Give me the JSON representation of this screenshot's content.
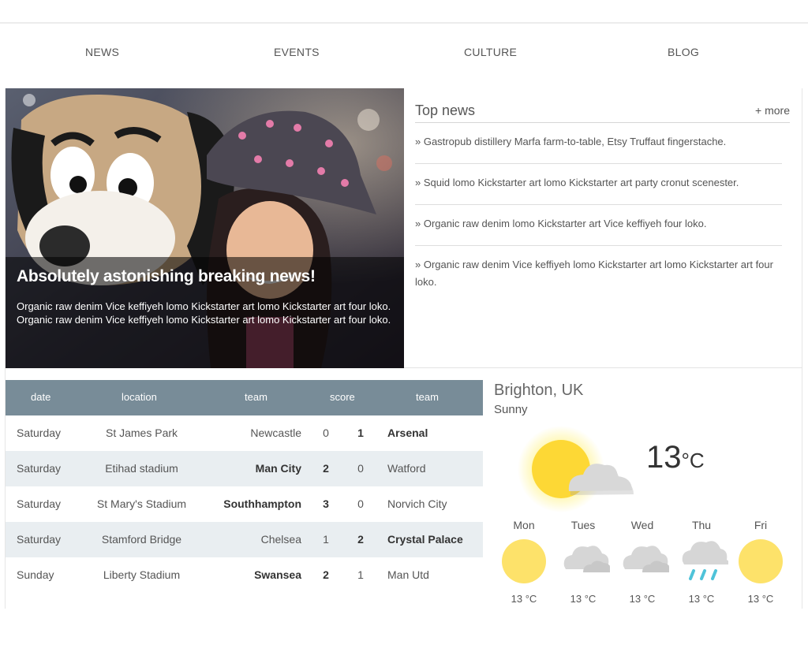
{
  "nav": {
    "items": [
      "NEWS",
      "EVENTS",
      "CULTURE",
      "BLOG"
    ]
  },
  "hero": {
    "title": "Absolutely astonishing breaking news!",
    "text": "Organic raw denim Vice keffiyeh lomo Kickstarter art lomo Kickstarter art four loko. Organic raw denim Vice keffiyeh lomo Kickstarter art lomo Kickstarter art four loko."
  },
  "top_news": {
    "title": "Top news",
    "more": "+ more",
    "items": [
      "» Gastropub distillery Marfa farm-to-table, Etsy Truffaut fingerstache.",
      "» Squid lomo Kickstarter art lomo Kickstarter art party cronut scenester.",
      "» Organic raw denim lomo Kickstarter art Vice keffiyeh four loko.",
      "» Organic raw denim Vice keffiyeh lomo Kickstarter art lomo Kickstarter art four loko."
    ]
  },
  "scores": {
    "headers": [
      "date",
      "location",
      "team",
      "score",
      "team"
    ],
    "rows": [
      {
        "date": "Saturday",
        "location": "St James Park",
        "home": "Newcastle",
        "home_score": "0",
        "away_score": "1",
        "away": "Arsenal",
        "winner": "away"
      },
      {
        "date": "Saturday",
        "location": "Etihad stadium",
        "home": "Man City",
        "home_score": "2",
        "away_score": "0",
        "away": "Watford",
        "winner": "home"
      },
      {
        "date": "Saturday",
        "location": "St Mary's Stadium",
        "home": "Southhampton",
        "home_score": "3",
        "away_score": "0",
        "away": "Norvich City",
        "winner": "home"
      },
      {
        "date": "Saturday",
        "location": "Stamford Bridge",
        "home": "Chelsea",
        "home_score": "1",
        "away_score": "2",
        "away": "Crystal Palace",
        "winner": "away"
      },
      {
        "date": "Sunday",
        "location": "Liberty Stadium",
        "home": "Swansea",
        "home_score": "2",
        "away_score": "1",
        "away": "Man Utd",
        "winner": "home"
      }
    ]
  },
  "weather": {
    "city": "Brighton, UK",
    "condition": "Sunny",
    "temp": "13",
    "unit": "°C",
    "current_icon": "sun-cloud-icon",
    "forecast": [
      {
        "day": "Mon",
        "temp": "13 °C",
        "icon": "sun-icon"
      },
      {
        "day": "Tues",
        "temp": "13 °C",
        "icon": "cloud-icon"
      },
      {
        "day": "Wed",
        "temp": "13 °C",
        "icon": "cloud-icon"
      },
      {
        "day": "Thu",
        "temp": "13 °C",
        "icon": "rain-icon"
      },
      {
        "day": "Fri",
        "temp": "13 °C",
        "icon": "sun-icon"
      }
    ]
  },
  "colors": {
    "table_header": "#788c98",
    "table_alt_row": "#e9eef1",
    "sun": "#fdd835",
    "cloud": "#cfcfcf",
    "rain": "#4fc3d9"
  }
}
